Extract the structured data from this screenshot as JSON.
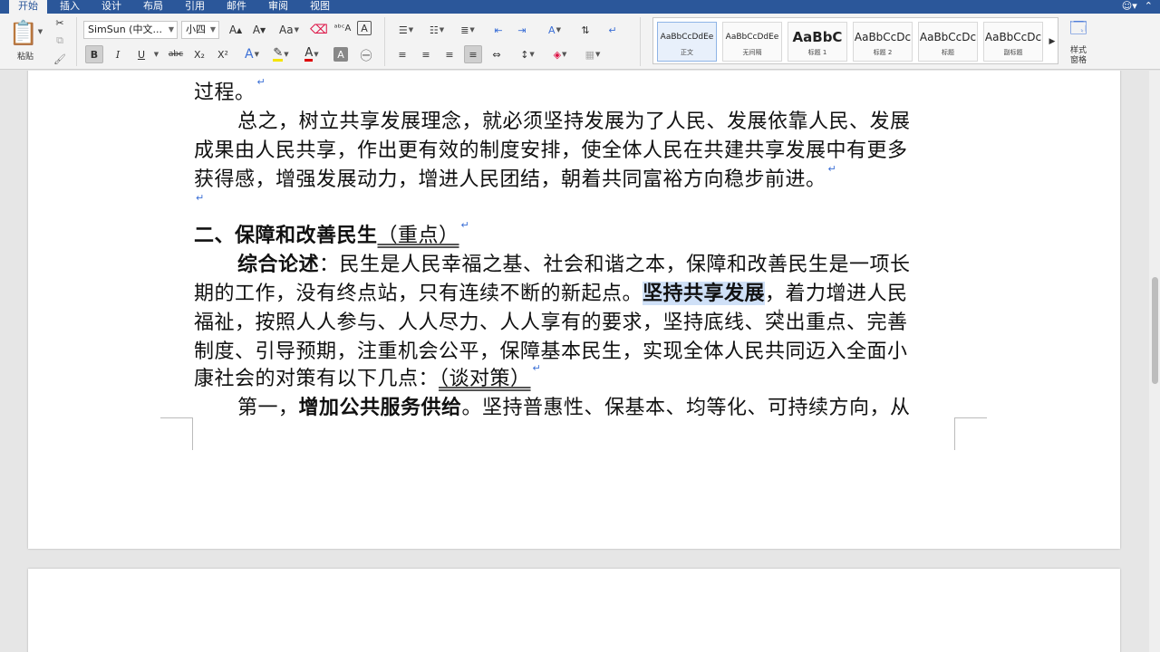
{
  "colors": {
    "ribbon_tab_bg": "#2b579a",
    "highlight": "#cfe0f7",
    "paragraph_mark": "#3b6fd6"
  },
  "tabs": [
    {
      "label": "开始",
      "active": true
    },
    {
      "label": "插入"
    },
    {
      "label": "设计"
    },
    {
      "label": "布局"
    },
    {
      "label": "引用"
    },
    {
      "label": "邮件"
    },
    {
      "label": "审阅"
    },
    {
      "label": "视图"
    }
  ],
  "ribbon": {
    "paste_label": "粘贴",
    "font_name": "SimSun (中文...",
    "font_size": "小四",
    "bold": "B",
    "italic": "I",
    "underline": "U",
    "strikethrough": "abc",
    "subscript": "X₂",
    "superscript": "X²",
    "styles": [
      {
        "preview": "AaBbCcDdEe",
        "name": "正文",
        "selected": true
      },
      {
        "preview": "AaBbCcDdEe",
        "name": "无间隔"
      },
      {
        "preview": "AaBbC",
        "name": "标题 1"
      },
      {
        "preview": "AaBbCcDc",
        "name": "标题 2"
      },
      {
        "preview": "AaBbCcDc",
        "name": "标题"
      },
      {
        "preview": "AaBbCcDc",
        "name": "副标题"
      }
    ],
    "styles_pane_line1": "样式",
    "styles_pane_line2": "窗格"
  },
  "document": {
    "lines": {
      "l1": "过程。",
      "l2": "总之，树立共享发展理念，就必须坚持发展为了人民、发展依靠人民、发展",
      "l3": "成果由人民共享，作出更有效的制度安排，使全体人民在共建共享发展中有更多",
      "l4": "获得感，增强发展动力，增进人民团结，朝着共同富裕方向稳步前进。",
      "l6a": "二、保障和改善民生",
      "l6b": "（重点）",
      "l7a": "综合论述",
      "l7b": "：民生是人民幸福之基、社会和谐之本，保障和改善民生是一项长",
      "l8a": "期的工作，没有终点站，只有连续不断的新起点。",
      "l8b": "坚持共享发展",
      "l8c": "，着力增进人民",
      "l9": "福祉，按照人人参与、人人尽力、人人享有的要求，坚持底线、突出重点、完善",
      "l10": "制度、引导预期，注重机会公平，保障基本民生，实现全体人民共同迈入全面小",
      "l11a": "康社会的对策有以下几点：",
      "l11b": "（谈对策）",
      "l12a": "第一，",
      "l12b": "增加公共服务供给",
      "l12c": "。坚持普惠性、保基本、均等化、可持续方向，从"
    },
    "paragraph_mark": "↵"
  }
}
